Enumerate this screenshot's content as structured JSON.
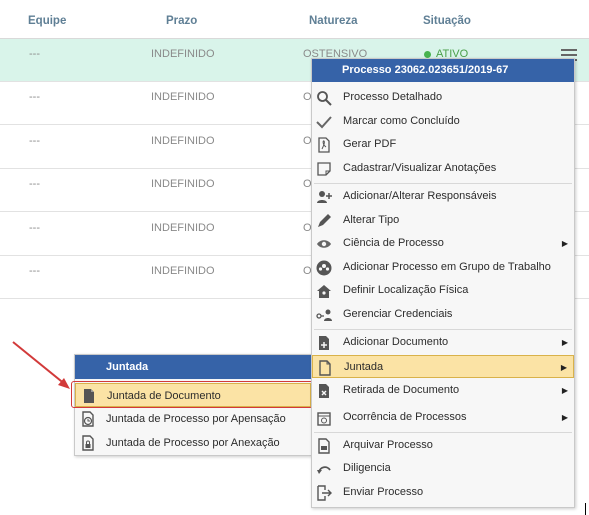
{
  "table": {
    "headers": {
      "equipe": "Equipe",
      "prazo": "Prazo",
      "natureza": "Natureza",
      "situacao": "Situação"
    },
    "rows": [
      {
        "equipe": "---",
        "prazo": "INDEFINIDO",
        "natureza": "OSTENSIVO",
        "situacao": "ATIVO"
      },
      {
        "equipe": "---",
        "prazo": "INDEFINIDO",
        "natureza": "O"
      },
      {
        "equipe": "---",
        "prazo": "INDEFINIDO",
        "natureza": "O"
      },
      {
        "equipe": "---",
        "prazo": "INDEFINIDO",
        "natureza": "O"
      },
      {
        "equipe": "---",
        "prazo": "INDEFINIDO",
        "natureza": "O"
      },
      {
        "equipe": "---",
        "prazo": "INDEFINIDO",
        "natureza": "O"
      }
    ]
  },
  "context_menu": {
    "title": "Processo 23062.023651/2019-67",
    "items": [
      {
        "label": "Processo Detalhado",
        "icon": "search-icon"
      },
      {
        "label": "Marcar como Concluído",
        "icon": "check-icon"
      },
      {
        "label": "Gerar PDF",
        "icon": "pdf-icon"
      },
      {
        "label": "Cadastrar/Visualizar Anotações",
        "icon": "note-icon"
      },
      {
        "label": "Adicionar/Alterar Responsáveis",
        "icon": "add-user-icon"
      },
      {
        "label": "Alterar Tipo",
        "icon": "pencil-icon"
      },
      {
        "label": "Ciência de Processo",
        "icon": "eye-icon"
      },
      {
        "label": "Adicionar Processo em Grupo de Trabalho",
        "icon": "group-icon"
      },
      {
        "label": "Definir Localização Física",
        "icon": "home-icon"
      },
      {
        "label": "Gerenciar Credenciais",
        "icon": "key-user-icon"
      },
      {
        "label": "Adicionar Documento",
        "icon": "add-document-icon"
      },
      {
        "label": "Juntada",
        "icon": "document-icon"
      },
      {
        "label": "Retirada de Documento",
        "icon": "remove-document-icon"
      },
      {
        "label": "Ocorrência de Processos",
        "icon": "calendar-icon"
      },
      {
        "label": "Arquivar Processo",
        "icon": "archive-icon"
      },
      {
        "label": "Diligencia",
        "icon": "undo-icon"
      },
      {
        "label": "Enviar Processo",
        "icon": "send-icon"
      }
    ]
  },
  "submenu": {
    "title": "Juntada",
    "items": [
      {
        "label": "Juntada de Documento",
        "icon": "document-icon"
      },
      {
        "label": "Juntada de Processo por Apensação",
        "icon": "clock-document-icon"
      },
      {
        "label": "Juntada de Processo por Anexação",
        "icon": "lock-document-icon"
      }
    ]
  },
  "colors": {
    "header_text": "#5f7f95",
    "selected_row": "#d9f4ea",
    "menu_title_bg": "#3663a8",
    "highlight_bg": "#fbe3a5",
    "annotation_red": "#d23a3a",
    "status_green": "#47b34f"
  }
}
